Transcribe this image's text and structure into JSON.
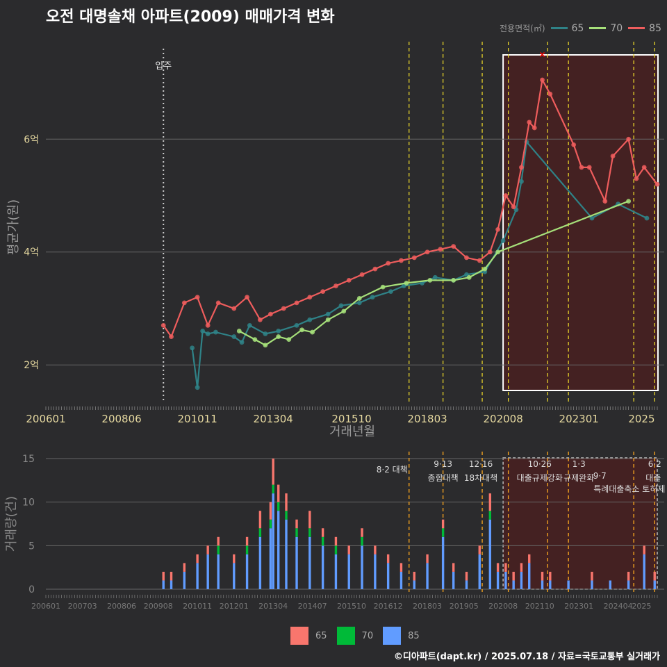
{
  "title": "오전 대명솔채 아파트(2009) 매매가격 변화",
  "legend": {
    "title": "전용면적(㎡)",
    "items": [
      {
        "label": "65",
        "color": "#2f8287"
      },
      {
        "label": "70",
        "color": "#a6e07a"
      },
      {
        "label": "85",
        "color": "#ef5d5d"
      }
    ]
  },
  "bar_legend": {
    "items": [
      {
        "label": "65",
        "color": "#f8766d"
      },
      {
        "label": "70",
        "color": "#00ba38"
      },
      {
        "label": "85",
        "color": "#619cff"
      }
    ]
  },
  "credit": "©디아파트(dapt.kr) / 2025.07.18 / 자료=국토교통부 실거래가",
  "chart_data": [
    {
      "type": "line",
      "title": "오전 대명솔채 아파트(2009) 매매가격 변화",
      "xlabel": "거래년월",
      "ylabel": "평균가(원)",
      "x_ticks": [
        "200601",
        "200806",
        "201011",
        "201304",
        "201510",
        "201803",
        "202008",
        "202301",
        "2025"
      ],
      "y_ticks": [
        {
          "value": 2,
          "label": "2억"
        },
        {
          "value": 4,
          "label": "4억"
        },
        {
          "value": 6,
          "label": "6억"
        }
      ],
      "ylim": [
        1.35,
        7.85
      ],
      "annotation": "입주",
      "highlight_box": {
        "from": "2020-08",
        "to": "2025-07"
      },
      "series": [
        {
          "name": "65",
          "points": [
            [
              "2010-09",
              2.3
            ],
            [
              "2010-11",
              1.6
            ],
            [
              "2011-01",
              2.6
            ],
            [
              "2011-03",
              2.55
            ],
            [
              "2011-06",
              2.58
            ],
            [
              "2012-01",
              2.5
            ],
            [
              "2012-04",
              2.4
            ],
            [
              "2012-07",
              2.7
            ],
            [
              "2013-01",
              2.55
            ],
            [
              "2013-06",
              2.6
            ],
            [
              "2014-01",
              2.7
            ],
            [
              "2014-06",
              2.8
            ],
            [
              "2015-01",
              2.9
            ],
            [
              "2015-06",
              3.05
            ],
            [
              "2016-01",
              3.1
            ],
            [
              "2016-06",
              3.2
            ],
            [
              "2017-01",
              3.3
            ],
            [
              "2017-06",
              3.4
            ],
            [
              "2018-01",
              3.45
            ],
            [
              "2018-06",
              3.55
            ],
            [
              "2019-01",
              3.5
            ],
            [
              "2019-06",
              3.6
            ],
            [
              "2020-01",
              3.65
            ],
            [
              "2020-08",
              4.2
            ],
            [
              "2021-01",
              4.75
            ],
            [
              "2021-03",
              5.25
            ],
            [
              "2021-05",
              5.95
            ],
            [
              "2023-06",
              4.6
            ],
            [
              "2024-04",
              4.85
            ],
            [
              "2025-03",
              4.6
            ]
          ]
        },
        {
          "name": "70",
          "points": [
            [
              "2012-03",
              2.6
            ],
            [
              "2012-09",
              2.45
            ],
            [
              "2013-01",
              2.35
            ],
            [
              "2013-06",
              2.5
            ],
            [
              "2013-10",
              2.45
            ],
            [
              "2014-03",
              2.62
            ],
            [
              "2014-07",
              2.58
            ],
            [
              "2015-01",
              2.8
            ],
            [
              "2015-07",
              2.95
            ],
            [
              "2016-01",
              3.18
            ],
            [
              "2016-10",
              3.38
            ],
            [
              "2017-07",
              3.45
            ],
            [
              "2018-04",
              3.5
            ],
            [
              "2019-01",
              3.5
            ],
            [
              "2019-07",
              3.55
            ],
            [
              "2020-01",
              3.7
            ],
            [
              "2020-06",
              4.0
            ],
            [
              "2024-08",
              4.9
            ]
          ]
        },
        {
          "name": "85",
          "points": [
            [
              "2009-10",
              2.7
            ],
            [
              "2010-01",
              2.5
            ],
            [
              "2010-06",
              3.1
            ],
            [
              "2010-11",
              3.2
            ],
            [
              "2011-03",
              2.7
            ],
            [
              "2011-07",
              3.1
            ],
            [
              "2012-01",
              3.0
            ],
            [
              "2012-06",
              3.2
            ],
            [
              "2012-11",
              2.8
            ],
            [
              "2013-03",
              2.9
            ],
            [
              "2013-08",
              3.0
            ],
            [
              "2014-01",
              3.1
            ],
            [
              "2014-06",
              3.2
            ],
            [
              "2014-11",
              3.3
            ],
            [
              "2015-04",
              3.4
            ],
            [
              "2015-09",
              3.5
            ],
            [
              "2016-02",
              3.6
            ],
            [
              "2016-07",
              3.7
            ],
            [
              "2016-12",
              3.8
            ],
            [
              "2017-05",
              3.85
            ],
            [
              "2017-10",
              3.9
            ],
            [
              "2018-03",
              4.0
            ],
            [
              "2018-08",
              4.05
            ],
            [
              "2019-01",
              4.1
            ],
            [
              "2019-06",
              3.9
            ],
            [
              "2019-11",
              3.85
            ],
            [
              "2020-03",
              4.0
            ],
            [
              "2020-06",
              4.4
            ],
            [
              "2020-09",
              5.0
            ],
            [
              "2020-12",
              4.8
            ],
            [
              "2021-03",
              5.5
            ],
            [
              "2021-06",
              6.3
            ],
            [
              "2021-08",
              6.2
            ],
            [
              "2021-11",
              7.05
            ],
            [
              "2022-02",
              6.8
            ],
            [
              "2022-11",
              5.9
            ],
            [
              "2023-02",
              5.5
            ],
            [
              "2023-05",
              5.5
            ],
            [
              "2023-11",
              4.9
            ],
            [
              "2024-02",
              5.7
            ],
            [
              "2024-08",
              6.0
            ],
            [
              "2024-11",
              5.3
            ],
            [
              "2025-02",
              5.5
            ],
            [
              "2025-07",
              5.2
            ]
          ]
        }
      ],
      "policy_lines": [
        "2017-08",
        "2018-09",
        "2019-12",
        "2020-10",
        "2022-01",
        "2022-09",
        "2024-10",
        "2025-06"
      ]
    },
    {
      "type": "bar",
      "xlabel": "",
      "ylabel": "거래량(건)",
      "x_ticks": [
        "200601",
        "200703",
        "200806",
        "200908",
        "201011",
        "201201",
        "201304",
        "201407",
        "201510",
        "201612",
        "201803",
        "201905",
        "202008",
        "202110",
        "202301",
        "202404",
        "2025"
      ],
      "y_ticks": [
        0,
        5,
        10,
        15
      ],
      "ylim": [
        0,
        15
      ],
      "series_names": [
        "65",
        "70",
        "85"
      ],
      "monthly_totals": [
        [
          "2009-10",
          2
        ],
        [
          "2010-01",
          2
        ],
        [
          "2010-06",
          3
        ],
        [
          "2010-11",
          4
        ],
        [
          "2011-03",
          5
        ],
        [
          "2011-07",
          6
        ],
        [
          "2012-01",
          4
        ],
        [
          "2012-06",
          6
        ],
        [
          "2012-11",
          9
        ],
        [
          "2013-03",
          10
        ],
        [
          "2013-04",
          15
        ],
        [
          "2013-06",
          12
        ],
        [
          "2013-09",
          11
        ],
        [
          "2014-01",
          8
        ],
        [
          "2014-06",
          9
        ],
        [
          "2014-11",
          7
        ],
        [
          "2015-04",
          6
        ],
        [
          "2015-09",
          5
        ],
        [
          "2016-02",
          7
        ],
        [
          "2016-07",
          5
        ],
        [
          "2016-12",
          4
        ],
        [
          "2017-05",
          3
        ],
        [
          "2017-10",
          2
        ],
        [
          "2018-03",
          4
        ],
        [
          "2018-09",
          8
        ],
        [
          "2019-01",
          3
        ],
        [
          "2019-06",
          2
        ],
        [
          "2019-11",
          5
        ],
        [
          "2020-03",
          11
        ],
        [
          "2020-06",
          3
        ],
        [
          "2020-09",
          3
        ],
        [
          "2020-12",
          2
        ],
        [
          "2021-03",
          3
        ],
        [
          "2021-06",
          4
        ],
        [
          "2021-11",
          2
        ],
        [
          "2022-02",
          2
        ],
        [
          "2022-09",
          1
        ],
        [
          "2023-06",
          2
        ],
        [
          "2024-01",
          1
        ],
        [
          "2024-08",
          2
        ],
        [
          "2025-02",
          5
        ],
        [
          "2025-06",
          2
        ]
      ],
      "annotations": [
        {
          "date": "2017-08",
          "label": "8·2 대책"
        },
        {
          "date": "2018-09",
          "label": "9·13"
        },
        {
          "date": "2018-09",
          "label": "종합대책"
        },
        {
          "date": "2019-12",
          "label": "12·16"
        },
        {
          "date": "2019-12",
          "label": "18차대책"
        },
        {
          "date": "2021-10",
          "label": "10·26"
        },
        {
          "date": "2021-10",
          "label": "대출규제강화"
        },
        {
          "date": "2023-01",
          "label": "1·3"
        },
        {
          "date": "2023-01",
          "label": "규제완화"
        },
        {
          "date": "2023-09",
          "label": "9·7"
        },
        {
          "date": "2023-09",
          "label": "특례대출축소 토허제 해"
        },
        {
          "date": "2025-06",
          "label": "6·2"
        },
        {
          "date": "2025-06",
          "label": "대출"
        }
      ]
    }
  ]
}
